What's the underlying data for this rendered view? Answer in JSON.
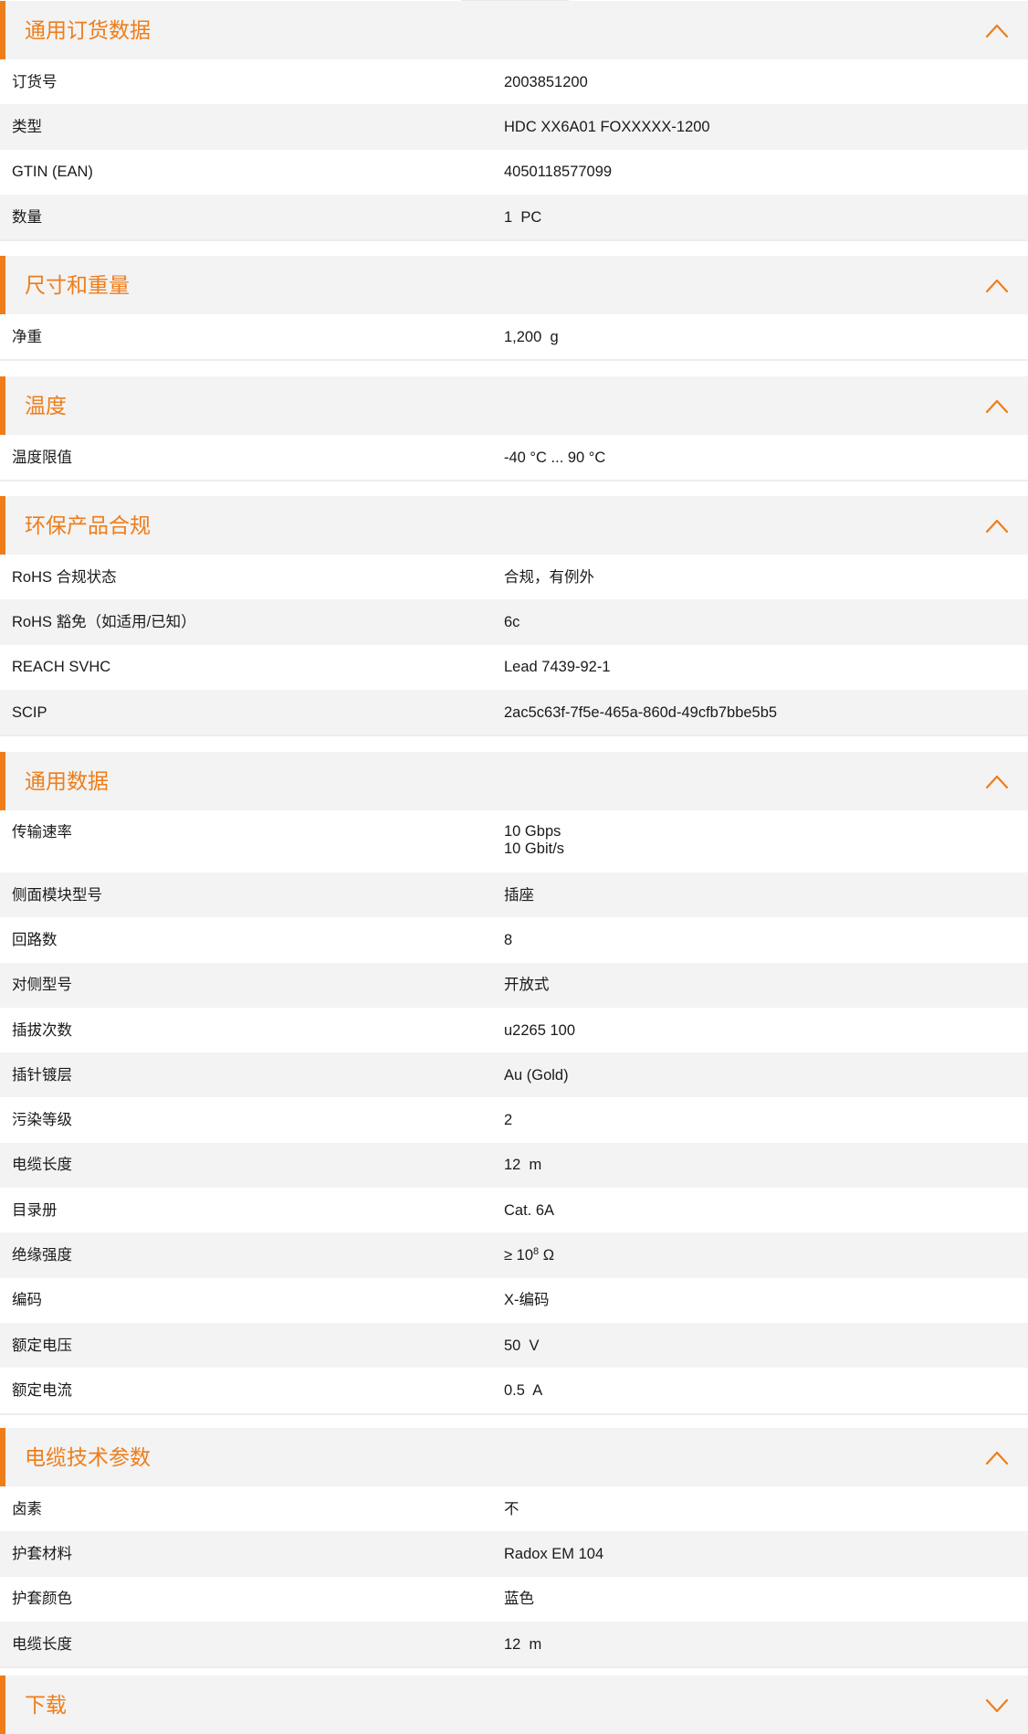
{
  "accent_color": "#ee7d1a",
  "sections": [
    {
      "title": "通用订货数据",
      "chevron": "chevron-up-icon",
      "rows": [
        {
          "label": "订货号",
          "value": "2003851200"
        },
        {
          "label": "类型",
          "value": "HDC XX6A01 FOXXXXX-1200"
        },
        {
          "label": "GTIN (EAN)",
          "value": "4050118577099"
        },
        {
          "label": "数量",
          "value": "1  PC"
        }
      ]
    },
    {
      "title": "尺寸和重量",
      "chevron": "chevron-up-icon",
      "rows": [
        {
          "label": "净重",
          "value": "1,200  g"
        }
      ]
    },
    {
      "title": "温度",
      "chevron": "chevron-up-icon",
      "rows": [
        {
          "label": "温度限值",
          "value": "-40 °C ... 90 °C"
        }
      ]
    },
    {
      "title": "环保产品合规",
      "chevron": "chevron-up-icon",
      "rows": [
        {
          "label": "RoHS 合规状态",
          "value": "合规，有例外"
        },
        {
          "label": "RoHS 豁免（如适用/已知）",
          "value": "6c"
        },
        {
          "label": "REACH SVHC",
          "value": "Lead 7439-92-1"
        },
        {
          "label": "SCIP",
          "value": "2ac5c63f-7f5e-465a-860d-49cfb7bbe5b5"
        }
      ]
    },
    {
      "title": "通用数据",
      "chevron": "chevron-up-icon",
      "rows": [
        {
          "label": "传输速率",
          "value_lines": [
            "10 Gbps",
            "10 Gbit/s"
          ]
        },
        {
          "label": "侧面模块型号",
          "value": "插座"
        },
        {
          "label": "回路数",
          "value": "8"
        },
        {
          "label": "对侧型号",
          "value": "开放式"
        },
        {
          "label": "插拔次数",
          "value": "u2265 100"
        },
        {
          "label": "插针镀层",
          "value": "Au (Gold)"
        },
        {
          "label": "污染等级",
          "value": "2"
        },
        {
          "label": "电缆长度",
          "value": "12  m"
        },
        {
          "label": "目录册",
          "value": "Cat. 6A"
        },
        {
          "label": "绝缘强度",
          "value": "≥ 10",
          "value_sup": "8",
          "value_suffix": " Ω"
        },
        {
          "label": "编码",
          "value": "X-编码"
        },
        {
          "label": "额定电压",
          "value": "50  V"
        },
        {
          "label": "额定电流",
          "value": "0.5  A"
        }
      ]
    },
    {
      "title": "电缆技术参数",
      "chevron": "chevron-up-icon",
      "rows": [
        {
          "label": "卤素",
          "value": "不"
        },
        {
          "label": "护套材料",
          "value": "Radox EM 104"
        },
        {
          "label": "护套颜色",
          "value": "蓝色"
        },
        {
          "label": "电缆长度",
          "value": "12  m"
        }
      ]
    },
    {
      "title": "下载",
      "chevron": "chevron-down-icon",
      "rows": []
    }
  ]
}
